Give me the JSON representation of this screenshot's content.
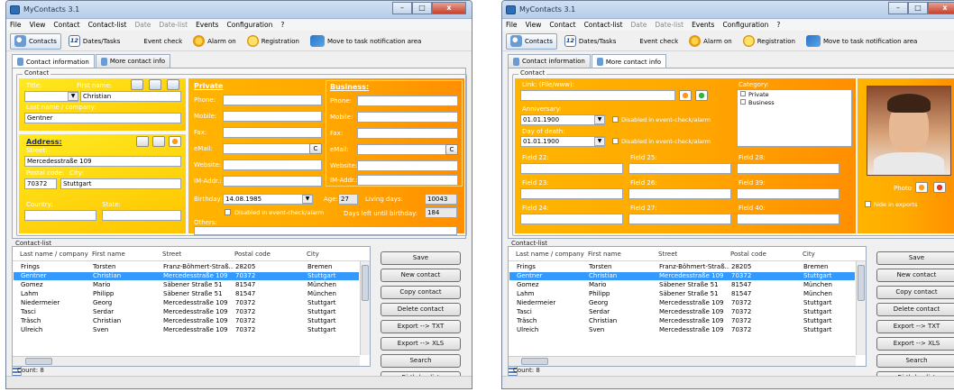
{
  "app": {
    "title": "MyContacts 3.1",
    "win_buttons": [
      "–",
      "□",
      "x"
    ]
  },
  "menu": [
    "File",
    "View",
    "Contact",
    "Contact-list",
    "Date",
    "Date-list",
    "Events",
    "Configuration",
    "?"
  ],
  "toolbar": {
    "contacts": "Contacts",
    "cal_day": "12",
    "dates_tasks": "Dates/Tasks",
    "event_check": "Event check",
    "alarm_on": "Alarm on",
    "registration": "Registration",
    "move_tray": "Move to task notification area"
  },
  "tabs": {
    "contact_info": "Contact information",
    "more_info": "More contact info"
  },
  "contact": {
    "group": "Contact",
    "title_label": "Title:",
    "firstname_label": "First name:",
    "firstname": "Christian",
    "lastname_label": "Last name / company:",
    "lastname": "Gentner",
    "address_heading": "Address:",
    "street_label": "Street:",
    "street": "Mercedesstraße 109",
    "postal_label": "Postal code:",
    "city_label": "City:",
    "postal": "70372",
    "city": "Stuttgart",
    "country_label": "Country:",
    "state_label": "State:",
    "private": {
      "heading": "Private",
      "phone": "Phone:",
      "mobile": "Mobile:",
      "fax": "Fax:",
      "email": "eMail:",
      "website": "Website:",
      "im": "IM-Addr.:"
    },
    "business": {
      "heading": "Business:",
      "phone": "Phone:",
      "mobile": "Mobile:",
      "fax": "Fax:",
      "email": "eMail:",
      "website": "Website:",
      "im": "IM-Addr.:"
    },
    "email_btn": "C",
    "birthday_label": "Birthday:",
    "birthday": "14.08.1985",
    "age_label": "Age:",
    "age": "27",
    "living_days_label": "Living days:",
    "living_days": "10043",
    "disabled_check": "Disabled in event-check/alarm",
    "days_left_label": "Days left until birthday:",
    "days_left": "184",
    "others_label": "Others:"
  },
  "more": {
    "group": "Contact",
    "link_label": "Link: (File/www):",
    "anniversary_label": "Anniversary:",
    "anniversary": "01.01.1900",
    "death_label": "Day of death:",
    "death": "01.01.1900",
    "disabled_check": "Disabled in event-check/alarm",
    "category_label": "Category:",
    "categories": [
      "Private",
      "Business"
    ],
    "fields": [
      "Field 22:",
      "Field 25:",
      "Field 28:",
      "Field 23:",
      "Field 26:",
      "Field 39:",
      "Field 24:",
      "Field 27:",
      "Field 40:"
    ],
    "photo_label": "Photo",
    "hide_exports": "hide in exports"
  },
  "contact_list": {
    "label": "Contact-list",
    "columns": [
      "Last name / company",
      "First name",
      "Street",
      "Postal code",
      "City"
    ],
    "rows": [
      [
        "Frings",
        "Torsten",
        "Franz-Böhmert-Straß...",
        "28205",
        "Bremen"
      ],
      [
        "Gentner",
        "Christian",
        "Mercedesstraße 109",
        "70372",
        "Stuttgart"
      ],
      [
        "Gomez",
        "Mario",
        "Säbener Straße 51",
        "81547",
        "München"
      ],
      [
        "Lahm",
        "Philipp",
        "Säbener Straße 51",
        "81547",
        "München"
      ],
      [
        "Niedermeier",
        "Georg",
        "Mercedesstraße 109",
        "70372",
        "Stuttgart"
      ],
      [
        "Tasci",
        "Serdar",
        "Mercedesstraße 109",
        "70372",
        "Stuttgart"
      ],
      [
        "Träsch",
        "Christian",
        "Mercedesstraße 109",
        "70372",
        "Stuttgart"
      ],
      [
        "Ulreich",
        "Sven",
        "Mercedesstraße 109",
        "70372",
        "Stuttgart"
      ]
    ],
    "selected_index": 1,
    "count": "Count: 8"
  },
  "buttons": [
    "Save",
    "New contact",
    "Copy contact",
    "Delete contact",
    "Export --> TXT",
    "Export --> XLS",
    "Search",
    "Birthday list"
  ],
  "colors": {
    "selection": "#3399ff",
    "orange": "#ffaa00",
    "yellow": "#ffea20"
  }
}
